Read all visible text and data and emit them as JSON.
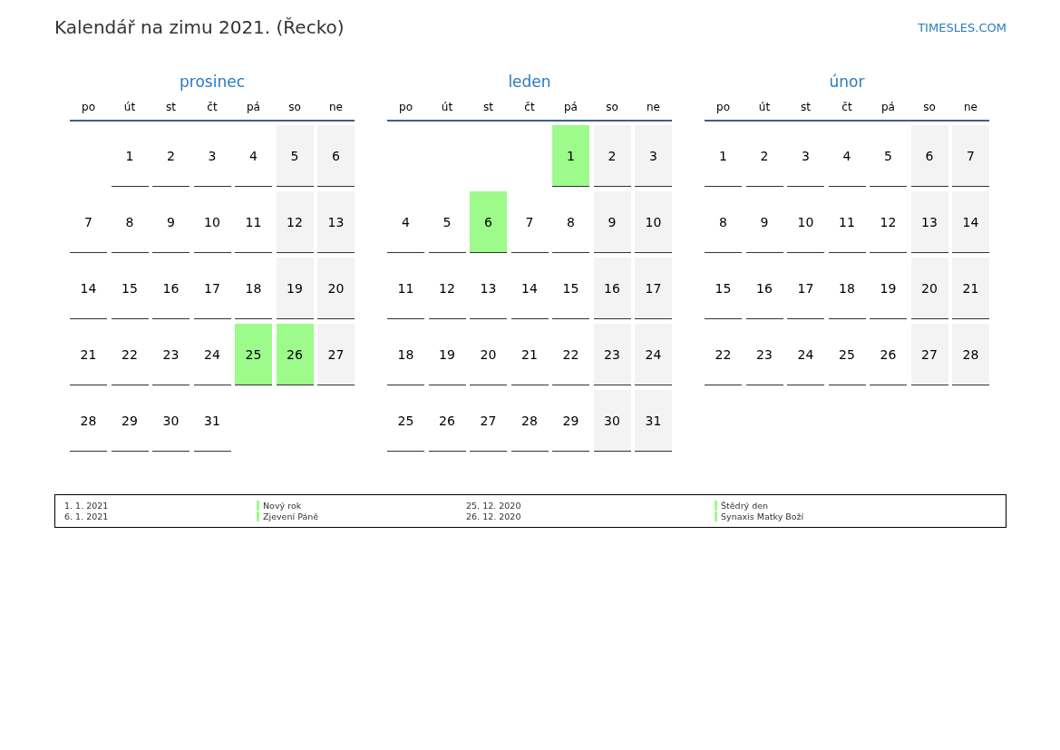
{
  "title": "Kalendář na zimu 2021. (Řecko)",
  "site_link": "TIMESLES.COM",
  "months": [
    {
      "name": "prosinec",
      "weekdays": [
        "po",
        "út",
        "st",
        "čt",
        "pá",
        "so",
        "ne"
      ],
      "weeks": [
        [
          {
            "kind": "blank"
          },
          {
            "day": "1",
            "kind": "weekday"
          },
          {
            "day": "2",
            "kind": "weekday"
          },
          {
            "day": "3",
            "kind": "weekday"
          },
          {
            "day": "4",
            "kind": "weekday"
          },
          {
            "day": "5",
            "kind": "weekend"
          },
          {
            "day": "6",
            "kind": "weekend"
          }
        ],
        [
          {
            "day": "7",
            "kind": "weekday"
          },
          {
            "day": "8",
            "kind": "weekday"
          },
          {
            "day": "9",
            "kind": "weekday"
          },
          {
            "day": "10",
            "kind": "weekday"
          },
          {
            "day": "11",
            "kind": "weekday"
          },
          {
            "day": "12",
            "kind": "weekend"
          },
          {
            "day": "13",
            "kind": "weekend"
          }
        ],
        [
          {
            "day": "14",
            "kind": "weekday"
          },
          {
            "day": "15",
            "kind": "weekday"
          },
          {
            "day": "16",
            "kind": "weekday"
          },
          {
            "day": "17",
            "kind": "weekday"
          },
          {
            "day": "18",
            "kind": "weekday"
          },
          {
            "day": "19",
            "kind": "weekend"
          },
          {
            "day": "20",
            "kind": "weekend"
          }
        ],
        [
          {
            "day": "21",
            "kind": "weekday"
          },
          {
            "day": "22",
            "kind": "weekday"
          },
          {
            "day": "23",
            "kind": "weekday"
          },
          {
            "day": "24",
            "kind": "weekday"
          },
          {
            "day": "25",
            "kind": "holiday"
          },
          {
            "day": "26",
            "kind": "holiday"
          },
          {
            "day": "27",
            "kind": "weekend"
          }
        ],
        [
          {
            "day": "28",
            "kind": "weekday"
          },
          {
            "day": "29",
            "kind": "weekday"
          },
          {
            "day": "30",
            "kind": "weekday"
          },
          {
            "day": "31",
            "kind": "weekday"
          },
          {
            "kind": "blank"
          },
          {
            "kind": "blank"
          },
          {
            "kind": "blank"
          }
        ]
      ]
    },
    {
      "name": "leden",
      "weekdays": [
        "po",
        "út",
        "st",
        "čt",
        "pá",
        "so",
        "ne"
      ],
      "weeks": [
        [
          {
            "kind": "blank"
          },
          {
            "kind": "blank"
          },
          {
            "kind": "blank"
          },
          {
            "kind": "blank"
          },
          {
            "day": "1",
            "kind": "holiday"
          },
          {
            "day": "2",
            "kind": "weekend"
          },
          {
            "day": "3",
            "kind": "weekend"
          }
        ],
        [
          {
            "day": "4",
            "kind": "weekday"
          },
          {
            "day": "5",
            "kind": "weekday"
          },
          {
            "day": "6",
            "kind": "holiday"
          },
          {
            "day": "7",
            "kind": "weekday"
          },
          {
            "day": "8",
            "kind": "weekday"
          },
          {
            "day": "9",
            "kind": "weekend"
          },
          {
            "day": "10",
            "kind": "weekend"
          }
        ],
        [
          {
            "day": "11",
            "kind": "weekday"
          },
          {
            "day": "12",
            "kind": "weekday"
          },
          {
            "day": "13",
            "kind": "weekday"
          },
          {
            "day": "14",
            "kind": "weekday"
          },
          {
            "day": "15",
            "kind": "weekday"
          },
          {
            "day": "16",
            "kind": "weekend"
          },
          {
            "day": "17",
            "kind": "weekend"
          }
        ],
        [
          {
            "day": "18",
            "kind": "weekday"
          },
          {
            "day": "19",
            "kind": "weekday"
          },
          {
            "day": "20",
            "kind": "weekday"
          },
          {
            "day": "21",
            "kind": "weekday"
          },
          {
            "day": "22",
            "kind": "weekday"
          },
          {
            "day": "23",
            "kind": "weekend"
          },
          {
            "day": "24",
            "kind": "weekend"
          }
        ],
        [
          {
            "day": "25",
            "kind": "weekday"
          },
          {
            "day": "26",
            "kind": "weekday"
          },
          {
            "day": "27",
            "kind": "weekday"
          },
          {
            "day": "28",
            "kind": "weekday"
          },
          {
            "day": "29",
            "kind": "weekday"
          },
          {
            "day": "30",
            "kind": "weekend"
          },
          {
            "day": "31",
            "kind": "weekend"
          }
        ]
      ]
    },
    {
      "name": "únor",
      "weekdays": [
        "po",
        "út",
        "st",
        "čt",
        "pá",
        "so",
        "ne"
      ],
      "weeks": [
        [
          {
            "day": "1",
            "kind": "weekday"
          },
          {
            "day": "2",
            "kind": "weekday"
          },
          {
            "day": "3",
            "kind": "weekday"
          },
          {
            "day": "4",
            "kind": "weekday"
          },
          {
            "day": "5",
            "kind": "weekday"
          },
          {
            "day": "6",
            "kind": "weekend"
          },
          {
            "day": "7",
            "kind": "weekend"
          }
        ],
        [
          {
            "day": "8",
            "kind": "weekday"
          },
          {
            "day": "9",
            "kind": "weekday"
          },
          {
            "day": "10",
            "kind": "weekday"
          },
          {
            "day": "11",
            "kind": "weekday"
          },
          {
            "day": "12",
            "kind": "weekday"
          },
          {
            "day": "13",
            "kind": "weekend"
          },
          {
            "day": "14",
            "kind": "weekend"
          }
        ],
        [
          {
            "day": "15",
            "kind": "weekday"
          },
          {
            "day": "16",
            "kind": "weekday"
          },
          {
            "day": "17",
            "kind": "weekday"
          },
          {
            "day": "18",
            "kind": "weekday"
          },
          {
            "day": "19",
            "kind": "weekday"
          },
          {
            "day": "20",
            "kind": "weekend"
          },
          {
            "day": "21",
            "kind": "weekend"
          }
        ],
        [
          {
            "day": "22",
            "kind": "weekday"
          },
          {
            "day": "23",
            "kind": "weekday"
          },
          {
            "day": "24",
            "kind": "weekday"
          },
          {
            "day": "25",
            "kind": "weekday"
          },
          {
            "day": "26",
            "kind": "weekday"
          },
          {
            "day": "27",
            "kind": "weekend"
          },
          {
            "day": "28",
            "kind": "weekend"
          }
        ]
      ]
    }
  ],
  "holidays": [
    {
      "date": "1. 1. 2021",
      "name": "Nový rok"
    },
    {
      "date": "25. 12. 2020",
      "name": "Štědrý den"
    },
    {
      "date": "6. 1. 2021",
      "name": "Zjevení Páně"
    },
    {
      "date": "26. 12. 2020",
      "name": "Synaxis Matky Boží"
    }
  ]
}
